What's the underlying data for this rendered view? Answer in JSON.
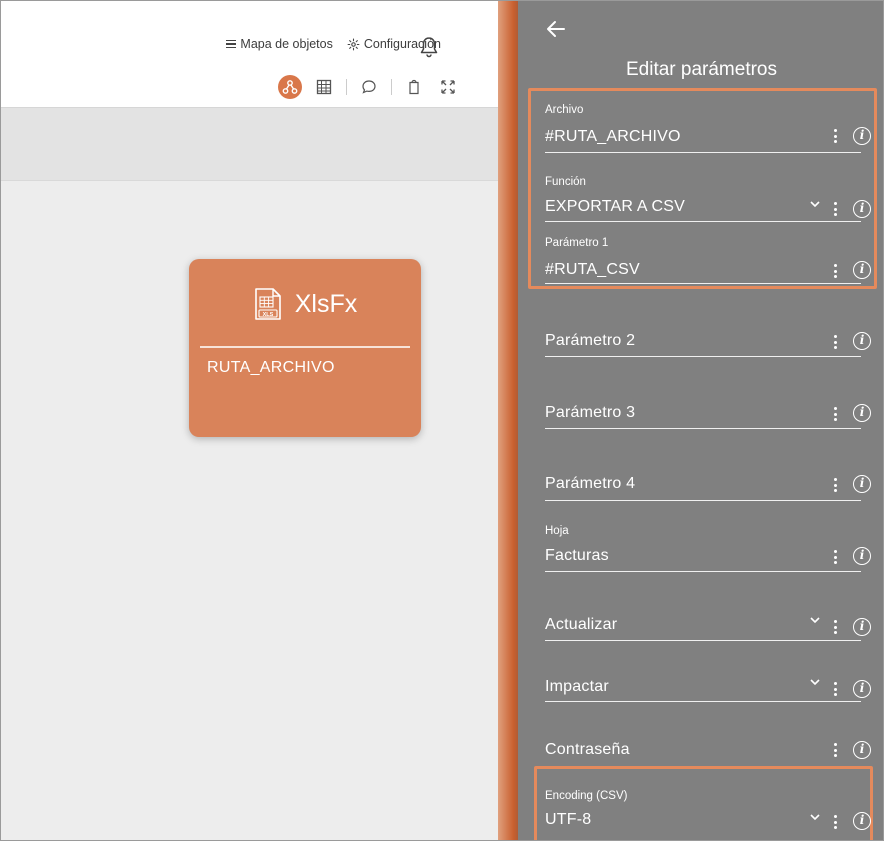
{
  "header": {
    "object_map_label": "Mapa de objetos",
    "settings_label": "Configuración"
  },
  "node": {
    "title": "XlsFx",
    "icon_text": "XLS",
    "subtitle": "RUTA_ARCHIVO"
  },
  "panel": {
    "title": "Editar parámetros",
    "fields": [
      {
        "label": "Archivo",
        "value": "#RUTA_ARCHIVO"
      },
      {
        "label": "Función",
        "value": "EXPORTAR A CSV"
      },
      {
        "label": "Parámetro 1",
        "value": "#RUTA_CSV"
      },
      {
        "label": "",
        "value": "Parámetro 2"
      },
      {
        "label": "",
        "value": "Parámetro 3"
      },
      {
        "label": "",
        "value": "Parámetro 4"
      },
      {
        "label": "Hoja",
        "value": "Facturas"
      },
      {
        "label": "",
        "value": "Actualizar"
      },
      {
        "label": "",
        "value": "Impactar"
      },
      {
        "label": "",
        "value": "Contraseña"
      },
      {
        "label": "Encoding (CSV)",
        "value": "UTF-8"
      }
    ]
  },
  "colors": {
    "accent": "#d9774a",
    "node": "#d9835a",
    "panel": "#808080",
    "highlight": "#e58a5c"
  }
}
